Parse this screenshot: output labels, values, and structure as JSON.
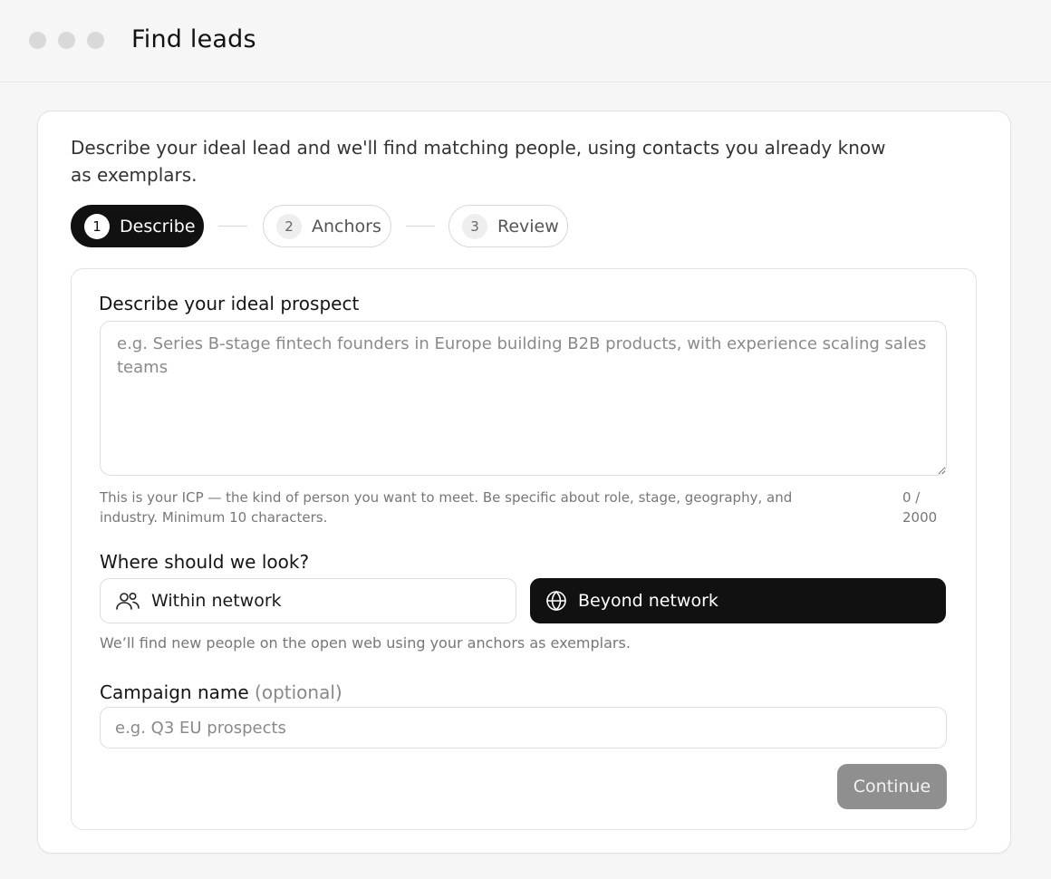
{
  "window": {
    "title": "Find leads"
  },
  "intro": "Describe your ideal lead and we'll find matching people, using contacts you already know as exemplars.",
  "stepper": {
    "steps": [
      {
        "number": "1",
        "label": "Describe",
        "active": true
      },
      {
        "number": "2",
        "label": "Anchors",
        "active": false
      },
      {
        "number": "3",
        "label": "Review",
        "active": false
      }
    ]
  },
  "prospect": {
    "label": "Describe your ideal prospect",
    "placeholder": "e.g. Series B-stage fintech founders in Europe building B2B products, with experience scaling sales teams",
    "value": "",
    "helper": "This is your ICP — the kind of person you want to meet. Be specific about role, stage, geography, and industry. Minimum 10 characters.",
    "counter": "0 / 2000"
  },
  "search_scope": {
    "label": "Where should we look?",
    "options": [
      {
        "label": "Within network",
        "icon": "people-icon",
        "selected": false
      },
      {
        "label": "Beyond network",
        "icon": "globe-icon",
        "selected": true
      }
    ],
    "helper": "We’ll find new people on the open web using your anchors as exemplars."
  },
  "campaign": {
    "label": "Campaign name",
    "optional_tag": "(optional)",
    "placeholder": "e.g. Q3 EU prospects",
    "value": ""
  },
  "actions": {
    "continue_label": "Continue",
    "continue_enabled": false
  },
  "colors": {
    "accent": "#111111",
    "disabled_button": "#8f8f8f"
  }
}
